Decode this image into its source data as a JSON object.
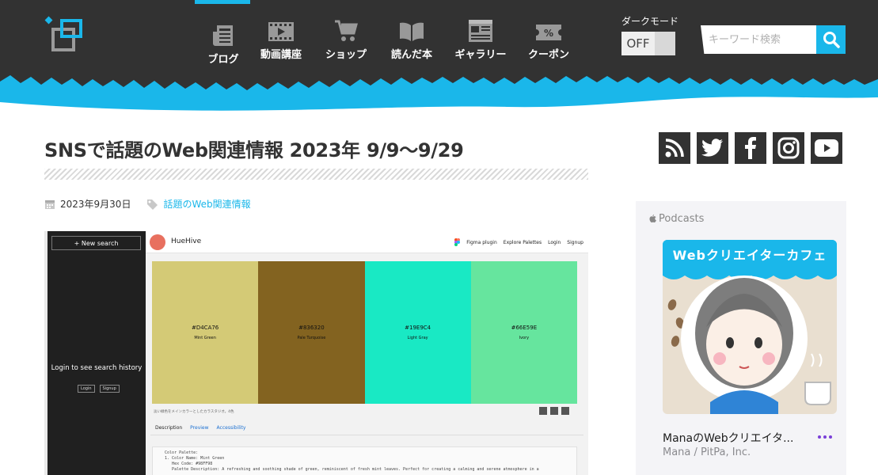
{
  "header": {
    "nav": [
      {
        "label": "ブログ",
        "icon": "newspaper-icon"
      },
      {
        "label": "動画講座",
        "icon": "film-icon"
      },
      {
        "label": "ショップ",
        "icon": "cart-icon"
      },
      {
        "label": "読んだ本",
        "icon": "book-icon"
      },
      {
        "label": "ギャラリー",
        "icon": "gallery-icon"
      },
      {
        "label": "クーポン",
        "icon": "coupon-icon"
      }
    ],
    "dark_mode_label": "ダークモード",
    "dark_mode_state": "OFF",
    "search_placeholder": "キーワード検索"
  },
  "article": {
    "title": "SNSで話題のWeb関連情報 2023年 9/9〜9/29",
    "date": "2023年9月30日",
    "category": "話題のWeb関連情報"
  },
  "screenshot": {
    "new_search": "+ New search",
    "login_message": "Login to see search history",
    "login_btn": "Login",
    "signup_btn": "Signup",
    "app_name": "HueHive",
    "top_links": [
      "Figma plugin",
      "Explore Palettes",
      "Login",
      "Signup"
    ],
    "swatches": [
      {
        "hex": "#D4CA76",
        "name": "Mint Green",
        "color": "#D4CA76"
      },
      {
        "hex": "#836320",
        "name": "Pale Turquoise",
        "color": "#836320"
      },
      {
        "hex": "#19E9C4",
        "name": "Light Gray",
        "color": "#19E9C4"
      },
      {
        "hex": "#66E59E",
        "name": "Ivory",
        "color": "#66E59E"
      }
    ],
    "caption": "淡い緑色をメインカラーとしたカラスタジオ。4色",
    "tabs": [
      "Description",
      "Preview",
      "Accessibility"
    ],
    "code_text": "   Color Palette:\n   1. Color Name: Mint Green\n      Hex Code: #98FF98\n      Palette Description: A refreshing and soothing shade of green, reminiscent of fresh mint leaves. Perfect for creating a calming and serene atmosphere in a"
  },
  "sidebar": {
    "social": [
      "rss-icon",
      "twitter-icon",
      "facebook-icon",
      "instagram-icon",
      "youtube-icon"
    ],
    "podcasts_label": "Podcasts",
    "artwork_title": "Webクリエイターカフェ",
    "show_title": "ManaのWebクリエイタ...",
    "publisher": "Mana / PitPa, Inc."
  },
  "colors": {
    "accent": "#1ab7ea",
    "header_bg": "#323232"
  }
}
